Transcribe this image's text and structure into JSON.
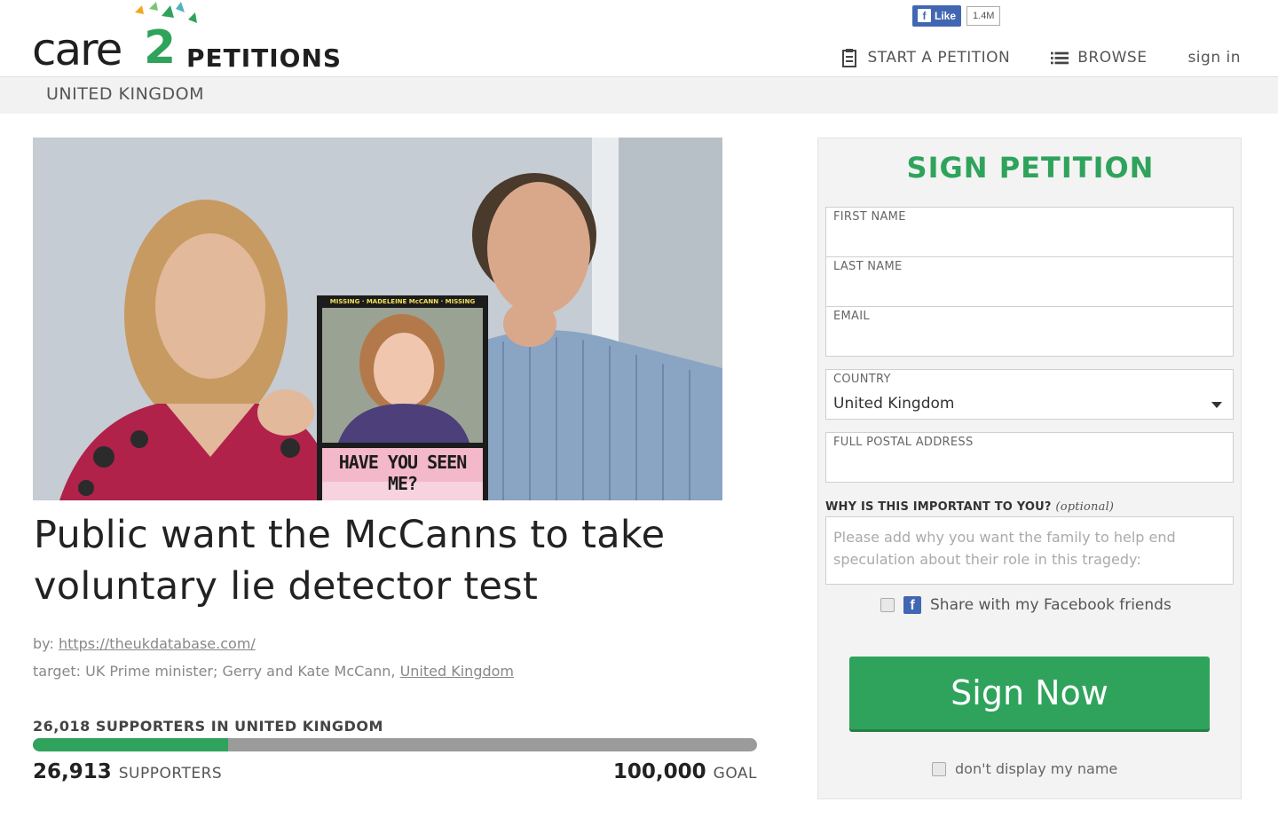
{
  "header": {
    "logo_text": "care",
    "logo_number": "2",
    "logo_product": "PETITIONS",
    "fb_like_label": "Like",
    "fb_like_count": "1.4M",
    "nav": {
      "start_petition": "START A PETITION",
      "browse": "BROWSE",
      "sign_in": "sign in"
    },
    "region": "UNITED KINGDOM"
  },
  "petition": {
    "title": "Public want the McCanns to take voluntary lie detector test",
    "by_label": "by:",
    "by_link": "https://theukdatabase.com/",
    "target_label": "target:",
    "target_text": "UK Prime minister; Gerry and Kate McCann,",
    "target_link": "United Kingdom",
    "image_poster_banner": "MISSING · MADELEINE McCANN · MISSING",
    "image_poster_caption": "HAVE YOU SEEN ME?",
    "supporters_region": "26,018 SUPPORTERS IN UNITED KINGDOM",
    "supporters_count": "26,913",
    "supporters_label": "SUPPORTERS",
    "goal_count": "100,000",
    "goal_label": "GOAL",
    "progress_fraction": 0.269
  },
  "form": {
    "title": "SIGN PETITION",
    "first_name_label": "FIRST NAME",
    "last_name_label": "LAST NAME",
    "email_label": "EMAIL",
    "country_label": "COUNTRY",
    "country_value": "United Kingdom",
    "address_label": "FULL POSTAL ADDRESS",
    "why_label": "WHY IS THIS IMPORTANT TO YOU?",
    "why_optional": "(optional)",
    "why_text": "Please add why you want the family to help end speculation about their role in this tragedy:",
    "share_label": "Share with my Facebook friends",
    "sign_button": "Sign Now",
    "hide_name_label": "don't display my name"
  },
  "colors": {
    "brand_green": "#2fa35b",
    "facebook_blue": "#4267b2",
    "progress_track": "#9b9b9b"
  }
}
